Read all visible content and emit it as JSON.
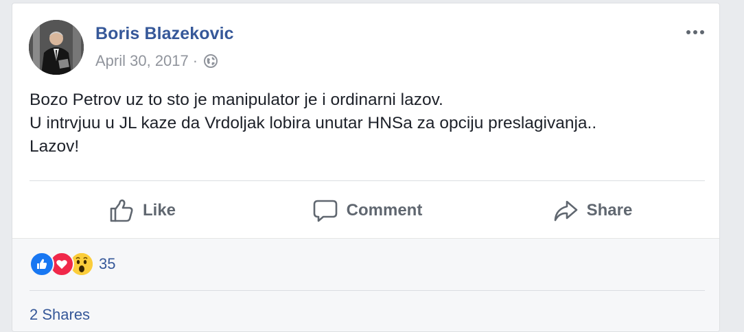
{
  "post": {
    "author": "Boris Blazekovic",
    "date": "April 30, 2017",
    "separator": "·",
    "privacy_icon": "globe-icon",
    "text_lines": [
      "Bozo Petrov uz to sto je manipulator je i ordinarni lazov.",
      "U intrvjuu u JL kaze da Vrdoljak lobira unutar HNSa za opciju preslagivanja..",
      "Lazov!"
    ]
  },
  "actions": {
    "like": "Like",
    "comment": "Comment",
    "share": "Share"
  },
  "reactions": {
    "icons": [
      "like-reaction-icon",
      "love-reaction-icon",
      "wow-reaction-icon"
    ],
    "count": "35"
  },
  "shares": "2 Shares",
  "colors": {
    "link": "#365899",
    "secondary": "#90949c",
    "action": "#606770",
    "like_blue": "#1877f2",
    "love_red": "#f0284a",
    "wow_yellow": "#fbcd3b"
  }
}
